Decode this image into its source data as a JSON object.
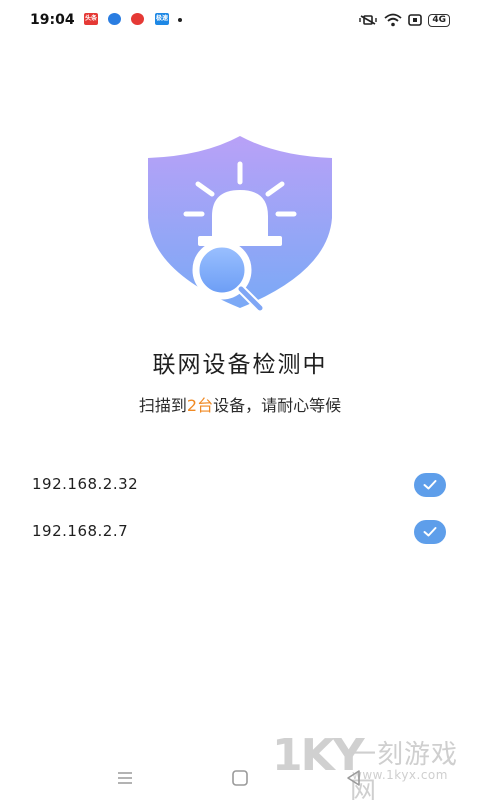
{
  "status_bar": {
    "time": "19:04",
    "notifications": [
      {
        "name": "toutiao-notification-icon",
        "color": "#e53935",
        "label": "头条"
      },
      {
        "name": "app-notification-icon-blue",
        "color": "#2a7de1",
        "label": ""
      },
      {
        "name": "app-notification-icon-red",
        "color": "#e53935",
        "label": ""
      },
      {
        "name": "app-notification-icon-cyan",
        "color": "#1e88e5",
        "label": "极速"
      }
    ],
    "network": "4G"
  },
  "scan": {
    "title": "联网设备检测中",
    "subtitle_prefix": "扫描到",
    "count": "2台",
    "subtitle_suffix": "设备，请耐心等候",
    "accent_color": "#f08a24"
  },
  "devices": [
    {
      "ip": "192.168.2.32",
      "status_icon": "check-icon"
    },
    {
      "ip": "192.168.2.7",
      "status_icon": "check-icon"
    }
  ],
  "colors": {
    "shield_top": "#b9a1f7",
    "shield_bottom": "#7aa9f6",
    "check_badge": "#5e9eea"
  },
  "navigation": {
    "menu": "menu-icon",
    "home": "home-icon",
    "back": "back-icon"
  },
  "watermark": {
    "logo": "1KY",
    "name": "一刻游戏网",
    "url": "www.1kyx.com"
  }
}
